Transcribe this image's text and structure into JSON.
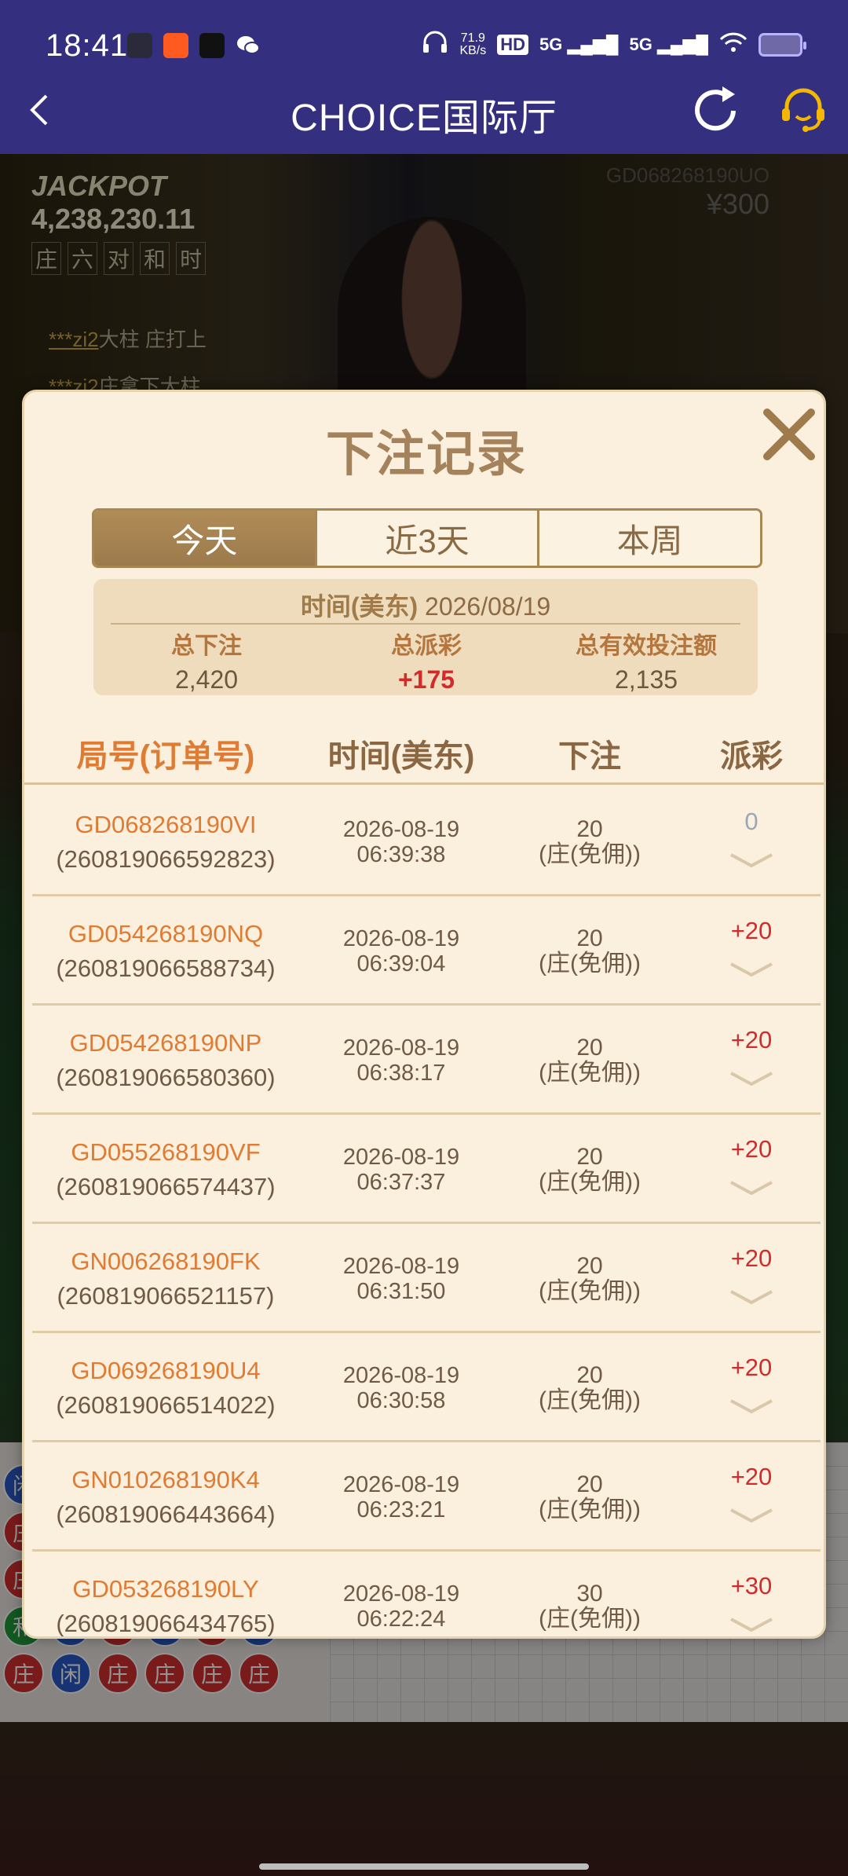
{
  "status_bar": {
    "time": "18:41",
    "net_speed_value": "71.9",
    "net_speed_unit": "KB/s",
    "hd_badge": "HD",
    "signal1": "5G",
    "signal2": "5G",
    "icons": [
      "notification-app-icon",
      "kuaishou-icon",
      "tiktok-icon",
      "wechat-icon",
      "headphones-icon",
      "wifi-icon",
      "battery-icon"
    ]
  },
  "header": {
    "title": "CHOICE国际厅",
    "back_icon": "chevron-left-icon",
    "refresh_icon": "refresh-icon",
    "support_icon": "customer-service-icon"
  },
  "background": {
    "jackpot_label": "JACKPOT",
    "jackpot_value": "4,238,230.11",
    "jackpot_bets": [
      "庄",
      "六",
      "对",
      "和",
      "时"
    ],
    "feed": [
      {
        "nick": "***zi2",
        "text": "大柱 庄打上"
      },
      {
        "nick": "***zi2",
        "text": "庄拿下大柱"
      }
    ],
    "game_id": "GD068268190UO",
    "bet_amount": "¥300"
  },
  "modal": {
    "title": "下注记录",
    "close_icon": "close-icon",
    "tabs": [
      {
        "label": "今天",
        "active": true
      },
      {
        "label": "近3天",
        "active": false
      },
      {
        "label": "本周",
        "active": false
      }
    ],
    "summary": {
      "date_label": "时间(美东)",
      "date_value": "2026/08/19",
      "total_bet_label": "总下注",
      "total_bet_value": "2,420",
      "total_payout_label": "总派彩",
      "total_payout_value": "+175",
      "total_valid_label": "总有效投注额",
      "total_valid_value": "2,135"
    },
    "columns": [
      "局号(订单号)",
      "时间(美东)",
      "下注",
      "派彩"
    ],
    "rows": [
      {
        "game_id": "GD068268190VI",
        "order": "(260819066592823)",
        "date": "2026-08-19",
        "time": "06:39:38",
        "bet": "20",
        "bet_type": "(庄(免佣))",
        "payout": "0"
      },
      {
        "game_id": "GD054268190NQ",
        "order": "(260819066588734)",
        "date": "2026-08-19",
        "time": "06:39:04",
        "bet": "20",
        "bet_type": "(庄(免佣))",
        "payout": "+20"
      },
      {
        "game_id": "GD054268190NP",
        "order": "(260819066580360)",
        "date": "2026-08-19",
        "time": "06:38:17",
        "bet": "20",
        "bet_type": "(庄(免佣))",
        "payout": "+20"
      },
      {
        "game_id": "GD055268190VF",
        "order": "(260819066574437)",
        "date": "2026-08-19",
        "time": "06:37:37",
        "bet": "20",
        "bet_type": "(庄(免佣))",
        "payout": "+20"
      },
      {
        "game_id": "GN006268190FK",
        "order": "(260819066521157)",
        "date": "2026-08-19",
        "time": "06:31:50",
        "bet": "20",
        "bet_type": "(庄(免佣))",
        "payout": "+20"
      },
      {
        "game_id": "GD069268190U4",
        "order": "(260819066514022)",
        "date": "2026-08-19",
        "time": "06:30:58",
        "bet": "20",
        "bet_type": "(庄(免佣))",
        "payout": "+20"
      },
      {
        "game_id": "GN010268190K4",
        "order": "(260819066443664)",
        "date": "2026-08-19",
        "time": "06:23:21",
        "bet": "20",
        "bet_type": "(庄(免佣))",
        "payout": "+20"
      },
      {
        "game_id": "GD053268190LY",
        "order": "(260819066434765)",
        "date": "2026-08-19",
        "time": "06:22:24",
        "bet": "30",
        "bet_type": "(庄(免佣))",
        "payout": "+30"
      }
    ]
  },
  "roadmap": {
    "beads": [
      [
        "闲",
        "庄",
        "闲",
        "和",
        "闲",
        "庄",
        "庄"
      ],
      [
        "庄",
        "闲",
        "闲",
        "庄",
        "庄",
        "闲",
        ""
      ],
      [
        "庄",
        "闲",
        "闲",
        "闲",
        "闲",
        "闲",
        ""
      ],
      [
        "和",
        "闲",
        "庄",
        "闲",
        "庄",
        "闲",
        ""
      ],
      [
        "庄",
        "闲",
        "庄",
        "庄",
        "庄",
        "庄",
        ""
      ]
    ]
  },
  "colors": {
    "header_bg": "#34307f",
    "modal_bg": "#fbf0de",
    "accent_gold": "#a88753",
    "accent_orange": "#e07b33",
    "payout_red": "#d32b2b"
  }
}
